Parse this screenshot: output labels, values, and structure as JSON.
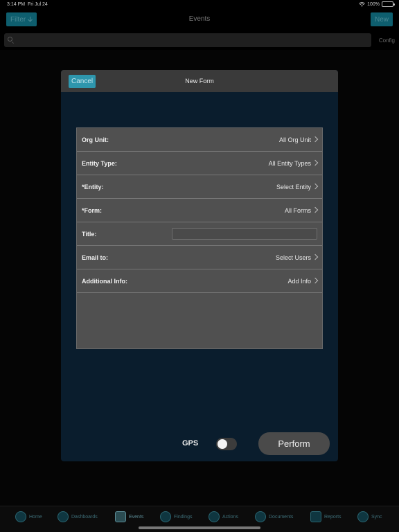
{
  "status": {
    "time": "3:14 PM",
    "date": "Fri Jul 24",
    "battery": "100%"
  },
  "nav": {
    "filter_label": "Filter",
    "title": "Events",
    "new_label": "New"
  },
  "search": {
    "placeholder": "",
    "config_label": "Config"
  },
  "modal": {
    "cancel_label": "Cancel",
    "title": "New Form",
    "rows": [
      {
        "label": "Org Unit:",
        "value": "All Org Unit"
      },
      {
        "label": "Entity Type:",
        "value": "All Entity Types"
      },
      {
        "label": "*Entity:",
        "value": "Select Entity"
      },
      {
        "label": "*Form:",
        "value": "All Forms"
      },
      {
        "label": "Title:",
        "value": ""
      },
      {
        "label": "Email to:",
        "value": "Select Users"
      },
      {
        "label": "Additional Info:",
        "value": "Add Info"
      }
    ],
    "gps_label": "GPS",
    "gps_enabled": false,
    "perform_label": "Perform"
  },
  "tabs": [
    {
      "label": "Home",
      "icon": "home-icon"
    },
    {
      "label": "Dashboards",
      "icon": "dashboard-icon"
    },
    {
      "label": "Events",
      "icon": "calendar-icon"
    },
    {
      "label": "Findings",
      "icon": "warning-icon"
    },
    {
      "label": "Actions",
      "icon": "actions-icon"
    },
    {
      "label": "Documents",
      "icon": "documents-icon"
    },
    {
      "label": "Reports",
      "icon": "reports-icon"
    },
    {
      "label": "Sync",
      "icon": "sync-icon"
    }
  ]
}
